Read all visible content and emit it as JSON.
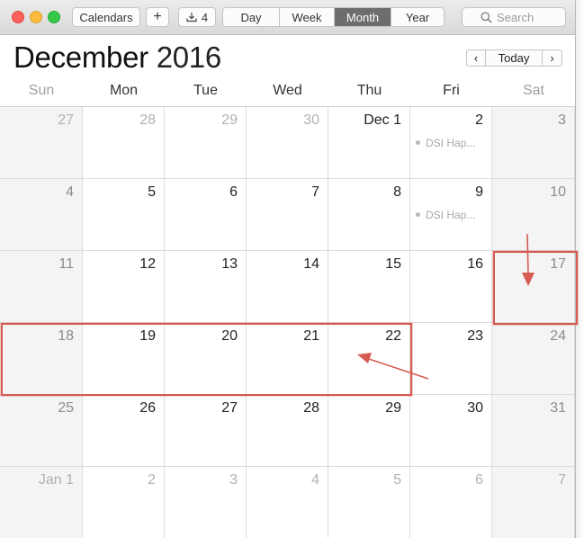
{
  "toolbar": {
    "calendars_label": "Calendars",
    "add_label": "+",
    "inbox_count": "4",
    "views": [
      {
        "label": "Day",
        "active": false
      },
      {
        "label": "Week",
        "active": false
      },
      {
        "label": "Month",
        "active": true
      },
      {
        "label": "Year",
        "active": false
      }
    ],
    "search_placeholder": "Search"
  },
  "header": {
    "month": "December",
    "year": "2016",
    "today_label": "Today",
    "prev_icon": "‹",
    "next_icon": "›"
  },
  "weekdays": [
    "Sun",
    "Mon",
    "Tue",
    "Wed",
    "Thu",
    "Fri",
    "Sat"
  ],
  "weeks": [
    [
      {
        "label": "27",
        "other": true
      },
      {
        "label": "28",
        "other": true
      },
      {
        "label": "29",
        "other": true
      },
      {
        "label": "30",
        "other": true
      },
      {
        "label": "Dec 1",
        "other": false
      },
      {
        "label": "2",
        "other": false,
        "event": "DSI Hap..."
      },
      {
        "label": "3",
        "other": false
      }
    ],
    [
      {
        "label": "4",
        "other": false
      },
      {
        "label": "5",
        "other": false
      },
      {
        "label": "6",
        "other": false
      },
      {
        "label": "7",
        "other": false
      },
      {
        "label": "8",
        "other": false
      },
      {
        "label": "9",
        "other": false,
        "event": "DSI Hap..."
      },
      {
        "label": "10",
        "other": false
      }
    ],
    [
      {
        "label": "11",
        "other": false
      },
      {
        "label": "12",
        "other": false
      },
      {
        "label": "13",
        "other": false
      },
      {
        "label": "14",
        "other": false
      },
      {
        "label": "15",
        "other": false
      },
      {
        "label": "16",
        "other": false
      },
      {
        "label": "17",
        "other": false
      }
    ],
    [
      {
        "label": "18",
        "other": false
      },
      {
        "label": "19",
        "other": false
      },
      {
        "label": "20",
        "other": false
      },
      {
        "label": "21",
        "other": false
      },
      {
        "label": "22",
        "other": false
      },
      {
        "label": "23",
        "other": false
      },
      {
        "label": "24",
        "other": false
      }
    ],
    [
      {
        "label": "25",
        "other": false
      },
      {
        "label": "26",
        "other": false
      },
      {
        "label": "27",
        "other": false
      },
      {
        "label": "28",
        "other": false
      },
      {
        "label": "29",
        "other": false
      },
      {
        "label": "30",
        "other": false
      },
      {
        "label": "31",
        "other": false
      }
    ],
    [
      {
        "label": "Jan 1",
        "other": true
      },
      {
        "label": "2",
        "other": true
      },
      {
        "label": "3",
        "other": true
      },
      {
        "label": "4",
        "other": true
      },
      {
        "label": "5",
        "other": true
      },
      {
        "label": "6",
        "other": true
      },
      {
        "label": "7",
        "other": true
      }
    ]
  ],
  "annotation_color": "#d65b52"
}
